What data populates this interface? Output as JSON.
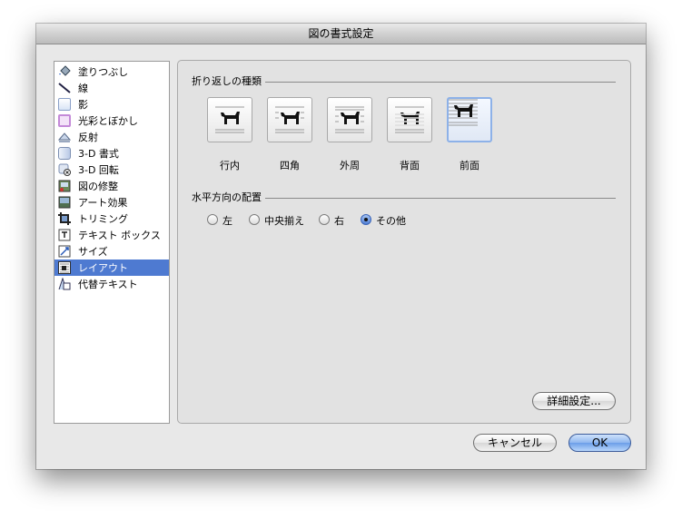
{
  "window": {
    "title": "図の書式設定"
  },
  "sidebar": {
    "items": [
      {
        "label": "塗りつぶし",
        "icon": "paint-bucket-icon"
      },
      {
        "label": "線",
        "icon": "line-icon"
      },
      {
        "label": "影",
        "icon": "shadow-icon"
      },
      {
        "label": "光彩とぼかし",
        "icon": "glow-icon"
      },
      {
        "label": "反射",
        "icon": "reflection-icon"
      },
      {
        "label": "3-D 書式",
        "icon": "3d-format-icon"
      },
      {
        "label": "3-D 回転",
        "icon": "3d-rotation-icon"
      },
      {
        "label": "図の修整",
        "icon": "picture-correction-icon"
      },
      {
        "label": "アート効果",
        "icon": "artistic-effects-icon"
      },
      {
        "label": "トリミング",
        "icon": "crop-icon"
      },
      {
        "label": "テキスト ボックス",
        "icon": "text-box-icon"
      },
      {
        "label": "サイズ",
        "icon": "size-icon"
      },
      {
        "label": "レイアウト",
        "icon": "layout-icon",
        "selected": true
      },
      {
        "label": "代替テキスト",
        "icon": "alt-text-icon"
      }
    ]
  },
  "wrap": {
    "section_label": "折り返しの種類",
    "options": [
      {
        "label": "行内",
        "icon": "wrap-inline-icon"
      },
      {
        "label": "四角",
        "icon": "wrap-square-icon"
      },
      {
        "label": "外周",
        "icon": "wrap-tight-icon"
      },
      {
        "label": "背面",
        "icon": "wrap-behind-text-icon"
      },
      {
        "label": "前面",
        "icon": "wrap-in-front-icon",
        "selected": true
      }
    ]
  },
  "alignment": {
    "section_label": "水平方向の配置",
    "options": [
      {
        "label": "左",
        "checked": false
      },
      {
        "label": "中央揃え",
        "checked": false
      },
      {
        "label": "右",
        "checked": false
      },
      {
        "label": "その他",
        "checked": true
      }
    ]
  },
  "buttons": {
    "advanced": "詳細設定...",
    "cancel": "キャンセル",
    "ok": "OK"
  },
  "colors": {
    "selection": "#4e7ad1",
    "ok_button": "#6b9ee8"
  }
}
